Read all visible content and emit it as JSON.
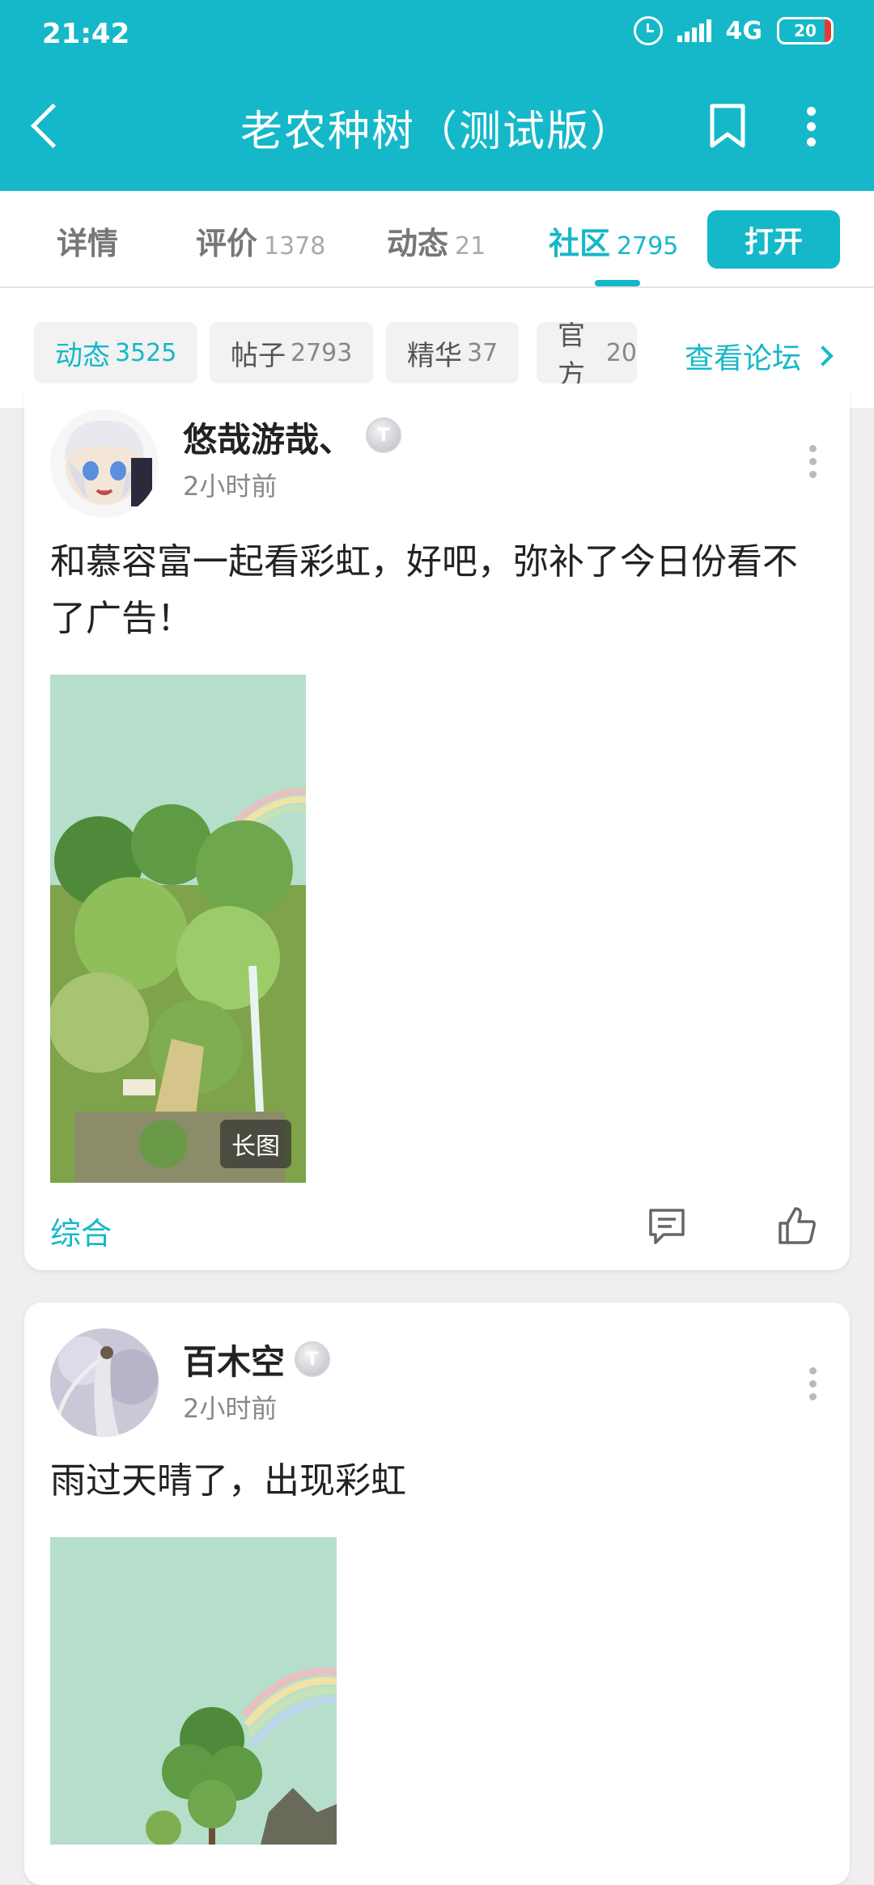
{
  "status_bar": {
    "time": "21:42",
    "network": "4G",
    "battery": "20"
  },
  "header": {
    "title": "老农种树（测试版）"
  },
  "tabs": [
    {
      "label": "详情",
      "count": ""
    },
    {
      "label": "评价",
      "count": "1378"
    },
    {
      "label": "动态",
      "count": "21"
    },
    {
      "label": "社区",
      "count": "2795"
    }
  ],
  "open_button": "打开",
  "filters": [
    {
      "label": "动态",
      "count": "3525"
    },
    {
      "label": "帖子",
      "count": "2793"
    },
    {
      "label": "精华",
      "count": "37"
    },
    {
      "label": "官方",
      "count": "20"
    }
  ],
  "forum_link": "查看论坛",
  "posts": [
    {
      "user": "悠哉游哉、",
      "badge_level": "3",
      "time": "2小时前",
      "text": "和慕容富一起看彩虹，好吧，弥补了今日份看不了广告！",
      "image_badge": "长图",
      "category": "综合"
    },
    {
      "user": "百木空",
      "badge_level": "2",
      "time": "2小时前",
      "text": "雨过天晴了，出现彩虹"
    }
  ],
  "colors": {
    "accent": "#15b8c8",
    "background": "#efefef"
  }
}
